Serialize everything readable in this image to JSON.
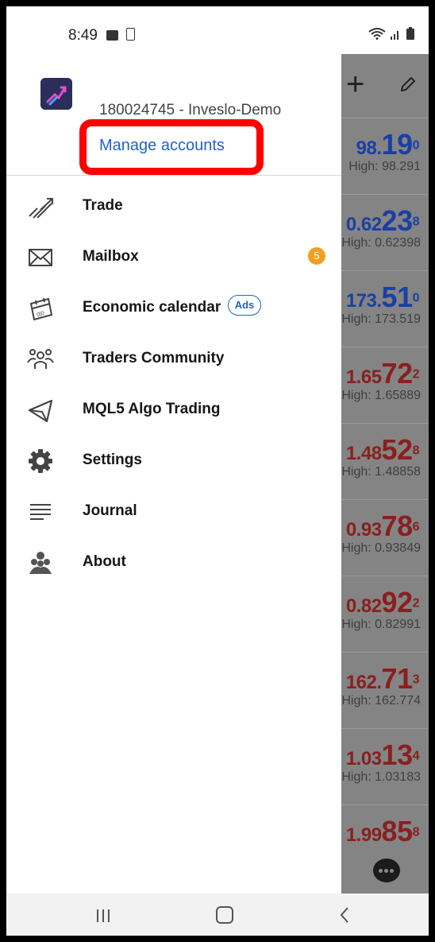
{
  "status_bar": {
    "time": "8:49"
  },
  "drawer": {
    "account": "180024745 - Inveslo-Demo",
    "manage_accounts": "Manage accounts",
    "menu": [
      {
        "label": "Trade",
        "icon": "trade-icon"
      },
      {
        "label": "Mailbox",
        "icon": "mail-icon",
        "badge": "5"
      },
      {
        "label": "Economic calendar",
        "icon": "calendar-icon",
        "tag": "Ads"
      },
      {
        "label": "Traders Community",
        "icon": "community-icon"
      },
      {
        "label": "MQL5 Algo Trading",
        "icon": "send-icon"
      },
      {
        "label": "Settings",
        "icon": "gear-icon"
      },
      {
        "label": "Journal",
        "icon": "journal-icon"
      },
      {
        "label": "About",
        "icon": "about-icon"
      }
    ]
  },
  "quotes": [
    {
      "small": "98.",
      "large": "19",
      "sup": "0",
      "high": "High: 98.291",
      "color": "#1a3fa6"
    },
    {
      "small": "0.62",
      "large": "23",
      "sup": "8",
      "high": "High: 0.62398",
      "color": "#1a3fa6"
    },
    {
      "small": "173.",
      "large": "51",
      "sup": "0",
      "high": "High: 173.519",
      "color": "#1a3fa6"
    },
    {
      "small": "1.65",
      "large": "72",
      "sup": "2",
      "high": "High: 1.65889",
      "color": "#8a1f1f"
    },
    {
      "small": "1.48",
      "large": "52",
      "sup": "8",
      "high": "High: 1.48858",
      "color": "#8a1f1f"
    },
    {
      "small": "0.93",
      "large": "78",
      "sup": "6",
      "high": "High: 0.93849",
      "color": "#8a1f1f"
    },
    {
      "small": "0.82",
      "large": "92",
      "sup": "2",
      "high": "High: 0.82991",
      "color": "#8a1f1f"
    },
    {
      "small": "162.",
      "large": "71",
      "sup": "3",
      "high": "High: 162.774",
      "color": "#8a1f1f"
    },
    {
      "small": "1.03",
      "large": "13",
      "sup": "4",
      "high": "High: 1.03183",
      "color": "#8a1f1f"
    },
    {
      "small": "1.99",
      "large": "85",
      "sup": "8",
      "high": "",
      "color": "#8a1f1f"
    }
  ]
}
